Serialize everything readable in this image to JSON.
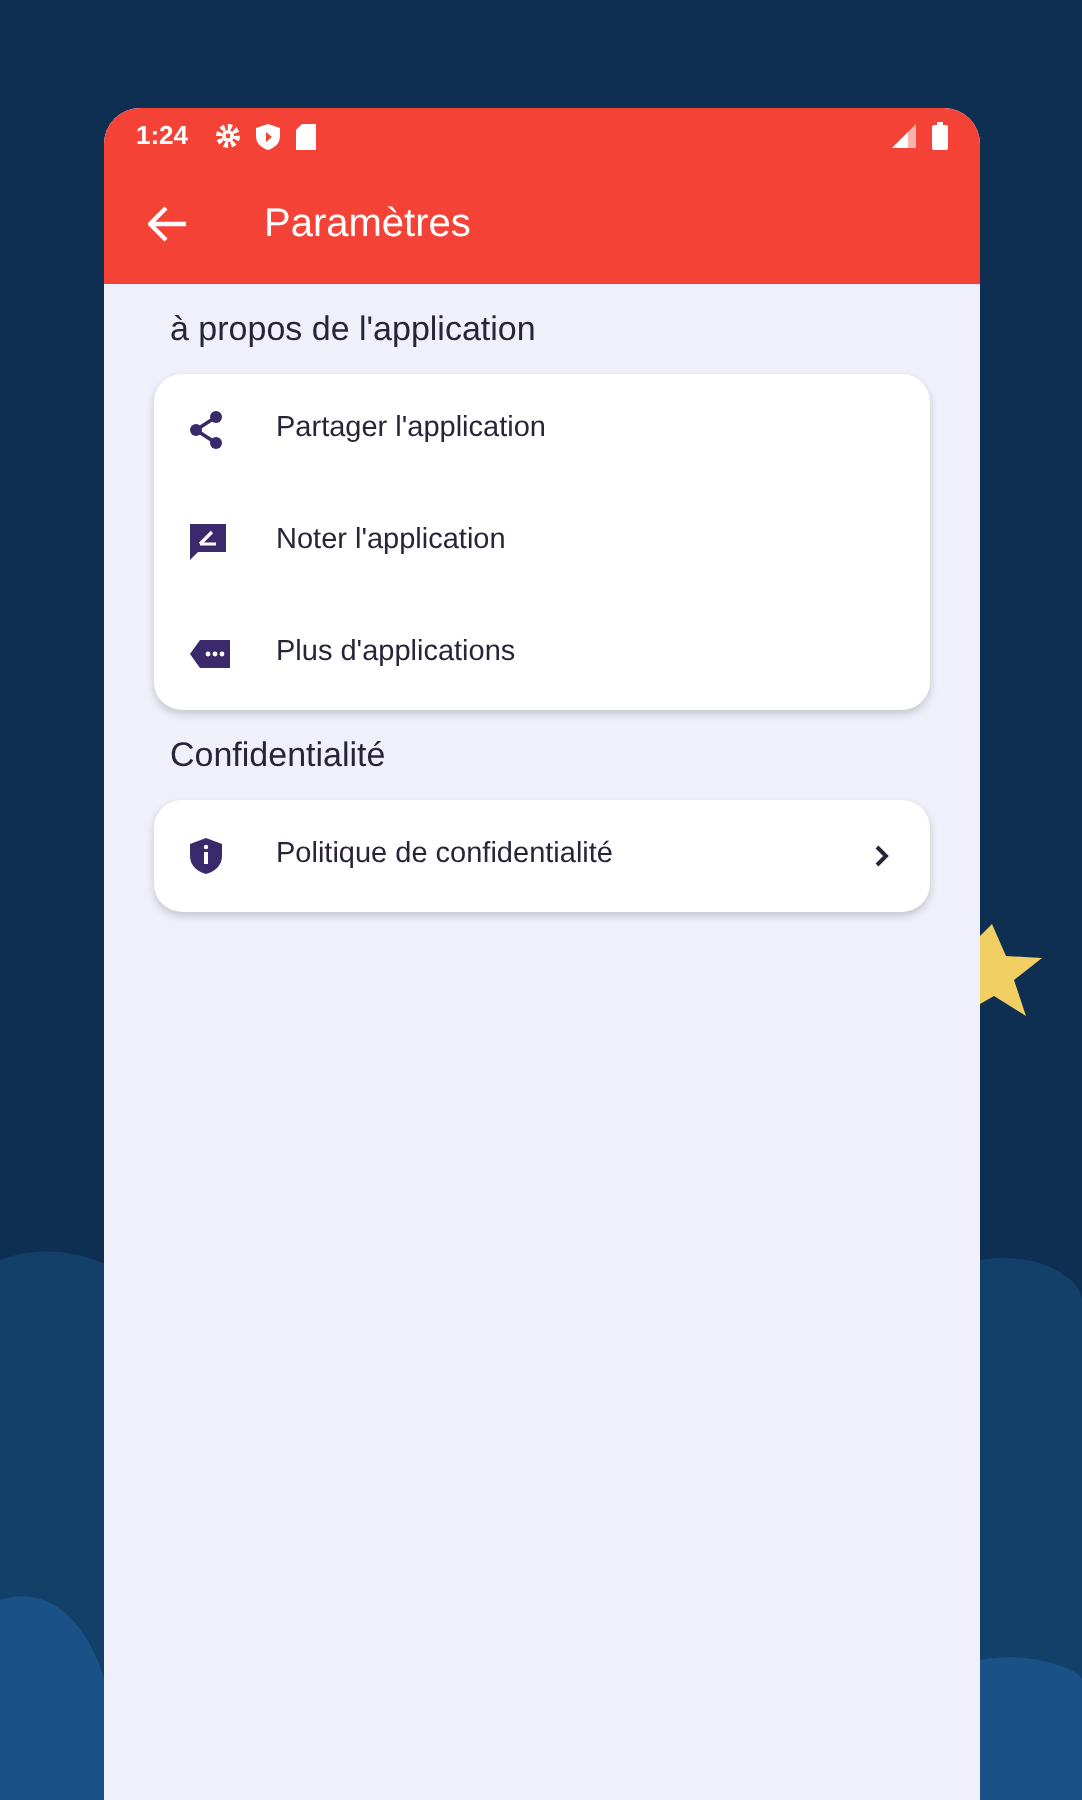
{
  "status_bar": {
    "time": "1:24"
  },
  "app_bar": {
    "title": "Paramètres"
  },
  "sections": [
    {
      "title": "à propos de l'application",
      "items": [
        {
          "kind": "share",
          "label": "Partager l'application",
          "has_chevron": false
        },
        {
          "kind": "rate",
          "label": "Noter l'application",
          "has_chevron": false
        },
        {
          "kind": "more",
          "label": "Plus d'applications",
          "has_chevron": false
        }
      ]
    },
    {
      "title": "Confidentialité",
      "items": [
        {
          "kind": "privacy",
          "label": "Politique de confidentialité",
          "has_chevron": true
        }
      ]
    }
  ]
}
